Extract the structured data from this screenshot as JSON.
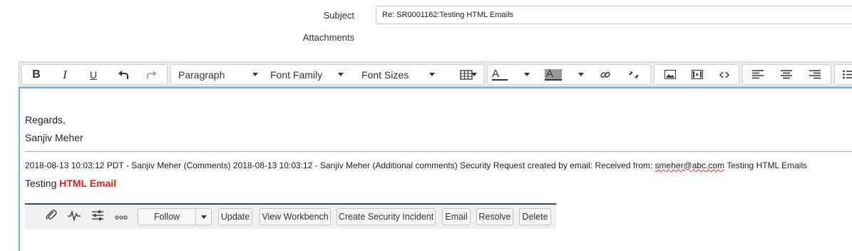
{
  "form": {
    "subject_label": "Subject",
    "subject_value": "Re: SR0001162:Testing HTML Emails",
    "attachments_label": "Attachments"
  },
  "toolbar": {
    "paragraph_label": "Paragraph",
    "font_family_label": "Font Family",
    "font_sizes_label": "Font Sizes",
    "font_color_glyph": "A",
    "bg_color_glyph": "A"
  },
  "editor": {
    "regards": "Regards,",
    "signature": "Sanjiv Meher",
    "history_prefix": "2018-08-13 10:03:12 PDT - Sanjiv Meher (Comments) 2018-08-13 10:03:12 - Sanjiv Meher (Additional comments) Security Request created by email: Received from: ",
    "history_email": "smeher@abc.com",
    "history_suffix": " Testing HTML Emails",
    "testing_prefix": "Testing ",
    "testing_bold": "HTML Email"
  },
  "action_bar": {
    "follow": "Follow",
    "update": "Update",
    "view_workbench": "View Workbench",
    "create_incident": "Create Security Incident",
    "email": "Email",
    "resolve": "Resolve",
    "delete": "Delete"
  },
  "colors": {
    "accent_red": "#ea1d1d",
    "editor_focus_border": "#7eaee8",
    "action_bar_top": "#3a4957"
  }
}
